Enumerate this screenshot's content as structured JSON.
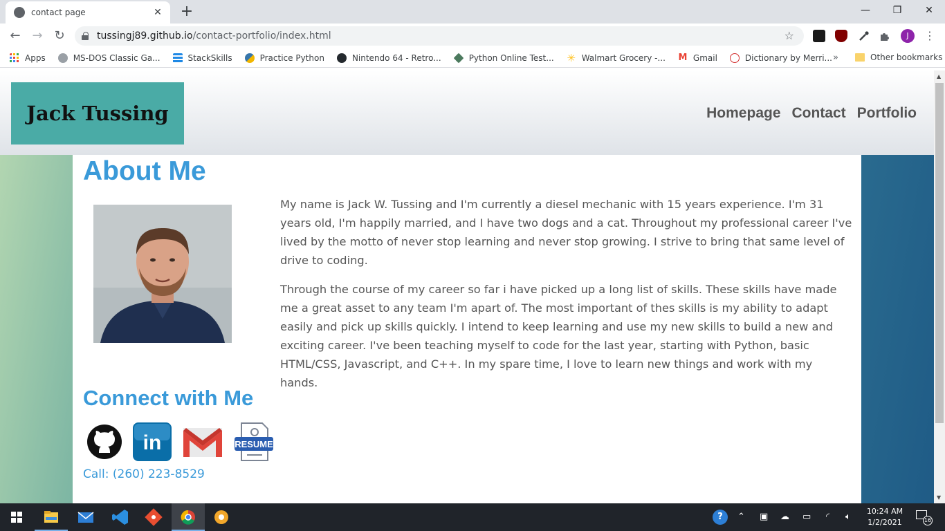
{
  "browser": {
    "tab_title": "contact page",
    "new_tab": "+",
    "url_host": "tussingj89.github.io",
    "url_path": "/contact-portfolio/index.html",
    "profile_initial": "J",
    "window_controls": {
      "minimize": "—",
      "restore": "❐",
      "close": "✕"
    }
  },
  "bookmarks": [
    {
      "label": "Apps",
      "icon": "apps-grid-icon",
      "color": "#e8453c"
    },
    {
      "label": "MS-DOS Classic Ga...",
      "icon": "msdos-icon",
      "color": "#8c8c8c"
    },
    {
      "label": "StackSkills",
      "icon": "stackskills-icon",
      "color": "#1e88e5"
    },
    {
      "label": "Practice Python",
      "icon": "python-icon",
      "color": "#f2b600"
    },
    {
      "label": "Nintendo 64 - Retro...",
      "icon": "github-icon",
      "color": "#24292e"
    },
    {
      "label": "Python Online Test...",
      "icon": "diamond-icon",
      "color": "#4c7a5e"
    },
    {
      "label": "Walmart Grocery -...",
      "icon": "walmart-icon",
      "color": "#ffc220"
    },
    {
      "label": "Gmail",
      "icon": "gmail-icon",
      "color": "#ea4335"
    },
    {
      "label": "Dictionary by Merri...",
      "icon": "merriam-icon",
      "color": "#d32f2f"
    }
  ],
  "bookmarks_more": "»",
  "other_bookmarks": "Other bookmarks",
  "site": {
    "brand": "Jack Tussing",
    "nav": [
      "Homepage",
      "Contact",
      "Portfolio"
    ],
    "about_heading": "About Me",
    "bio": [
      "My name is Jack W. Tussing and I'm currently a diesel mechanic with 15 years experience. I'm 31 years old, I'm happily married, and I have two dogs and a cat. Throughout my professional career I've lived by the motto of never stop learning and never stop growing. I strive to bring that same level of drive to coding.",
      "Through the course of my career so far i have picked up a long list of skills. These skills have made me a great asset to any team I'm apart of. The most important of thes skills is my ability to adapt easily and pick up skills quickly. I intend to keep learning and use my new skills to build a new and exciting career. I've been teaching myself to code for the last year, starting with Python, basic HTML/CSS, Javascript, and C++. In my spare time, I love to learn new things and work with my hands."
    ],
    "connect_heading": "Connect with Me",
    "contact_icons": [
      "github-icon",
      "linkedin-icon",
      "gmail-icon",
      "resume-icon"
    ],
    "resume_label": "RESUME",
    "linkedin_label": "in",
    "phone": "Call: (260) 223-8529",
    "colors": {
      "accent": "#3a9ad9",
      "logo_bg": "#4aaba6",
      "nav_text": "#555555"
    }
  },
  "taskbar": {
    "apps": [
      "start-icon",
      "file-explorer-icon",
      "mail-icon",
      "vscode-icon",
      "git-icon",
      "chrome-icon",
      "chrome-canary-icon"
    ],
    "time": "10:24 AM",
    "date": "1/2/2021",
    "notifications": "16"
  }
}
